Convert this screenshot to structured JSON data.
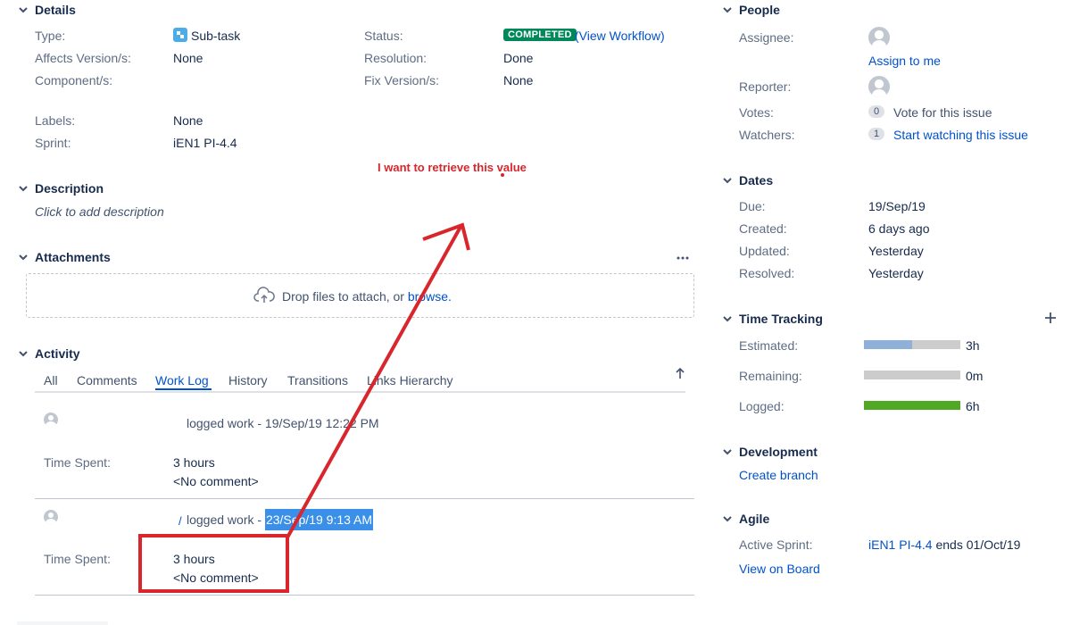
{
  "details": {
    "title": "Details",
    "type_label": "Type:",
    "type_value": "Sub-task",
    "affects_label": "Affects Version/s:",
    "affects_value": "None",
    "component_label": "Component/s:",
    "labels_label": "Labels:",
    "labels_value": "None",
    "sprint_label": "Sprint:",
    "sprint_value": "iEN1 PI-4.4",
    "status_label": "Status:",
    "status_value": "COMPLETED",
    "workflow_link": "(View Workflow)",
    "resolution_label": "Resolution:",
    "resolution_value": "Done",
    "fixversion_label": "Fix Version/s:",
    "fixversion_value": "None"
  },
  "annotation": {
    "text": "I want to retrieve this value",
    "color": "#d9262d"
  },
  "description": {
    "title": "Description",
    "placeholder": "Click to add description"
  },
  "attachments": {
    "title": "Attachments",
    "drop_text": "Drop files to attach, or ",
    "browse_link": "browse."
  },
  "activity": {
    "title": "Activity",
    "tabs": [
      "All",
      "Comments",
      "Work Log",
      "History",
      "Transitions",
      "Links Hierarchy"
    ],
    "active_tab": "Work Log",
    "entries": [
      {
        "header": "logged work - 19/Sep/19 12:22 PM",
        "time_label": "Time Spent:",
        "time_value": "3 hours",
        "comment": "<No comment>"
      },
      {
        "header_prefix": "logged work - ",
        "header_highlight": "23/Sep/19 9:13 AM",
        "time_label": "Time Spent:",
        "time_value": "3 hours",
        "comment": "<No comment>"
      }
    ]
  },
  "people": {
    "title": "People",
    "assignee_label": "Assignee:",
    "assign_link": "Assign to me",
    "reporter_label": "Reporter:",
    "votes_label": "Votes:",
    "votes_count": "0",
    "votes_link": "Vote for this issue",
    "watchers_label": "Watchers:",
    "watchers_count": "1",
    "watchers_link": "Start watching this issue"
  },
  "dates": {
    "title": "Dates",
    "due_label": "Due:",
    "due_value": "19/Sep/19",
    "created_label": "Created:",
    "created_value": "6 days ago",
    "updated_label": "Updated:",
    "updated_value": "Yesterday",
    "resolved_label": "Resolved:",
    "resolved_value": "Yesterday"
  },
  "time_tracking": {
    "title": "Time Tracking",
    "estimated_label": "Estimated:",
    "estimated_value": "3h",
    "estimated_fraction": 0.5,
    "remaining_label": "Remaining:",
    "remaining_value": "0m",
    "remaining_fraction": 0,
    "logged_label": "Logged:",
    "logged_value": "6h",
    "logged_fraction": 1,
    "colors": {
      "estimated": "#8eb0d9",
      "remaining": "#cccccc",
      "logged": "#51a825"
    }
  },
  "development": {
    "title": "Development",
    "create_branch": "Create branch"
  },
  "agile": {
    "title": "Agile",
    "active_sprint_label": "Active Sprint:",
    "active_sprint_link": "iEN1 PI-4.4",
    "active_sprint_suffix": " ends 01/Oct/19",
    "view_board": "View on Board"
  }
}
